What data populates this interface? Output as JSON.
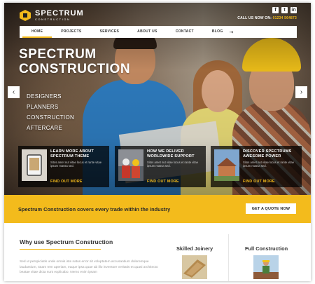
{
  "brand": {
    "name": "SPECTRUM",
    "sub": "CONSTRUCTION",
    "color": "#f2b91b"
  },
  "header": {
    "socials": [
      {
        "icon": "facebook-icon",
        "glyph": "f"
      },
      {
        "icon": "twitter-icon",
        "glyph": "t"
      },
      {
        "icon": "linkedin-icon",
        "glyph": "in"
      }
    ],
    "call_label": "CALL US NOW ON:",
    "phone": "01234 564873"
  },
  "nav": {
    "items": [
      "HOME",
      "PROJECTS",
      "SERVICES",
      "ABOUT US",
      "CONTACT",
      "BLOG"
    ],
    "active": "HOME",
    "extra_icon": "login-icon"
  },
  "hero": {
    "headline_1": "SPECTRUM",
    "headline_2": "CONSTRUCTION",
    "services": [
      "DESIGNERS",
      "PLANNERS",
      "CONSTRUCTION",
      "AFTERCARE"
    ],
    "prev_icon": "chevron-left-icon",
    "next_icon": "chevron-right-icon"
  },
  "cards": [
    {
      "title_1": "LEARN MORE ABOUT",
      "title_2": "SPECTRUM THEME",
      "text": "Sitos amet nut vitae locus et rante vitae ipsum massa sed.",
      "link": "FIND OUT MORE"
    },
    {
      "title_1": "HOW WE DELIVER",
      "title_2": "WORLDWIDE SUPPORT",
      "text": "Sitos amet nut vitae locus et rante vitae ipsum massa sed.",
      "link": "FIND OUT MORE"
    },
    {
      "title_1": "DISCOVER SPECTRUMS",
      "title_2": "AWESOME POWER",
      "text": "Sitos amet nut vitae locus et rante vitae ipsum massa sed.",
      "link": "FIND OUT MORE"
    }
  ],
  "band": {
    "text": "Spectrum Construction covers every trade within the industry",
    "button": "GET A QUOTE NOW"
  },
  "why": {
    "title": "Why use Spectrum Construction",
    "text": "Sed ut perspiciatis unde omnis iste natus error sit voluptatem accusantium doloremque laudantium, totam rem aperiam, eaque ipsa quae ab illo inventore veritatis et quasi architecto beatae vitae dicta sunt explicabo. Nemo enim ipsam"
  },
  "services": [
    {
      "title": "Skilled Joinery"
    },
    {
      "title": "Full Construction"
    }
  ]
}
